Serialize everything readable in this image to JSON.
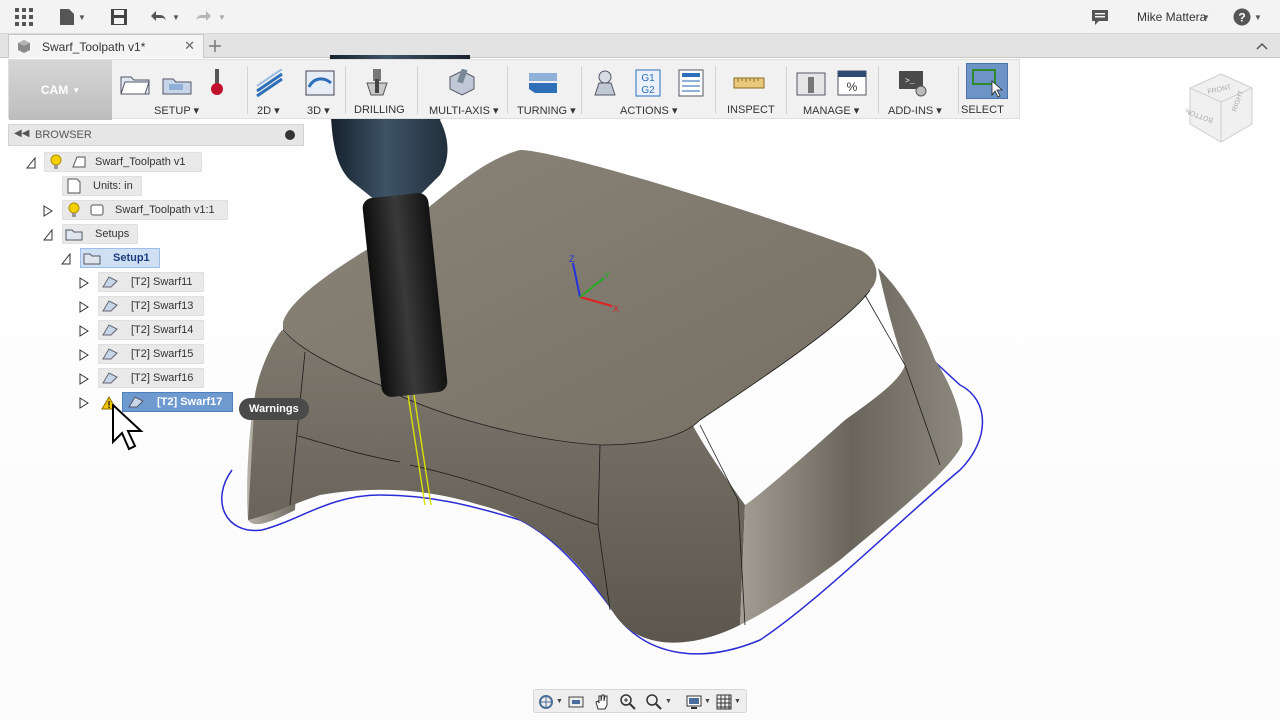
{
  "appbar": {
    "user_name": "Mike Mattera",
    "icons": [
      "grid-icon",
      "file-icon",
      "save-icon",
      "undo-icon",
      "redo-icon",
      "job-status-icon",
      "help-icon"
    ]
  },
  "tab": {
    "title": "Swarf_Toolpath v1*",
    "close": "✕"
  },
  "toolbar": {
    "workspace": "CAM",
    "groups": [
      {
        "label": "SETUP",
        "dropdown": true
      },
      {
        "label": "2D",
        "dropdown": true
      },
      {
        "label": "3D",
        "dropdown": true
      },
      {
        "label": "DRILLING",
        "dropdown": false
      },
      {
        "label": "MULTI-AXIS",
        "dropdown": true
      },
      {
        "label": "TURNING",
        "dropdown": true
      },
      {
        "label": "ACTIONS",
        "dropdown": true
      },
      {
        "label": "INSPECT",
        "dropdown": false
      },
      {
        "label": "MANAGE",
        "dropdown": true
      },
      {
        "label": "ADD-INS",
        "dropdown": true
      },
      {
        "label": "SELECT",
        "dropdown": false
      }
    ],
    "actions_icon_text": "G1\nG2"
  },
  "browser": {
    "title": "BROWSER",
    "root": "Swarf_Toolpath v1",
    "units": "Units: in",
    "component": "Swarf_Toolpath v1:1",
    "setups": "Setups",
    "setup1": "Setup1",
    "operations": [
      "[T2] Swarf11",
      "[T2] Swarf13",
      "[T2] Swarf14",
      "[T2] Swarf15",
      "[T2] Swarf16"
    ],
    "warning_op": "[T2] Swarf17"
  },
  "tooltip": "Warnings",
  "viewcube": {
    "front": "FRONT",
    "right": "RIGHT",
    "bottom": "BOTTOM"
  },
  "triad": {
    "x": "X",
    "y": "Y",
    "z": "Z"
  },
  "colors": {
    "toolpath": "#2b2bd6",
    "selected_blue": "#6f9ad0",
    "body": "#7a7469",
    "tool_shank": "#1e1e1e",
    "warning": "#f5c400"
  }
}
